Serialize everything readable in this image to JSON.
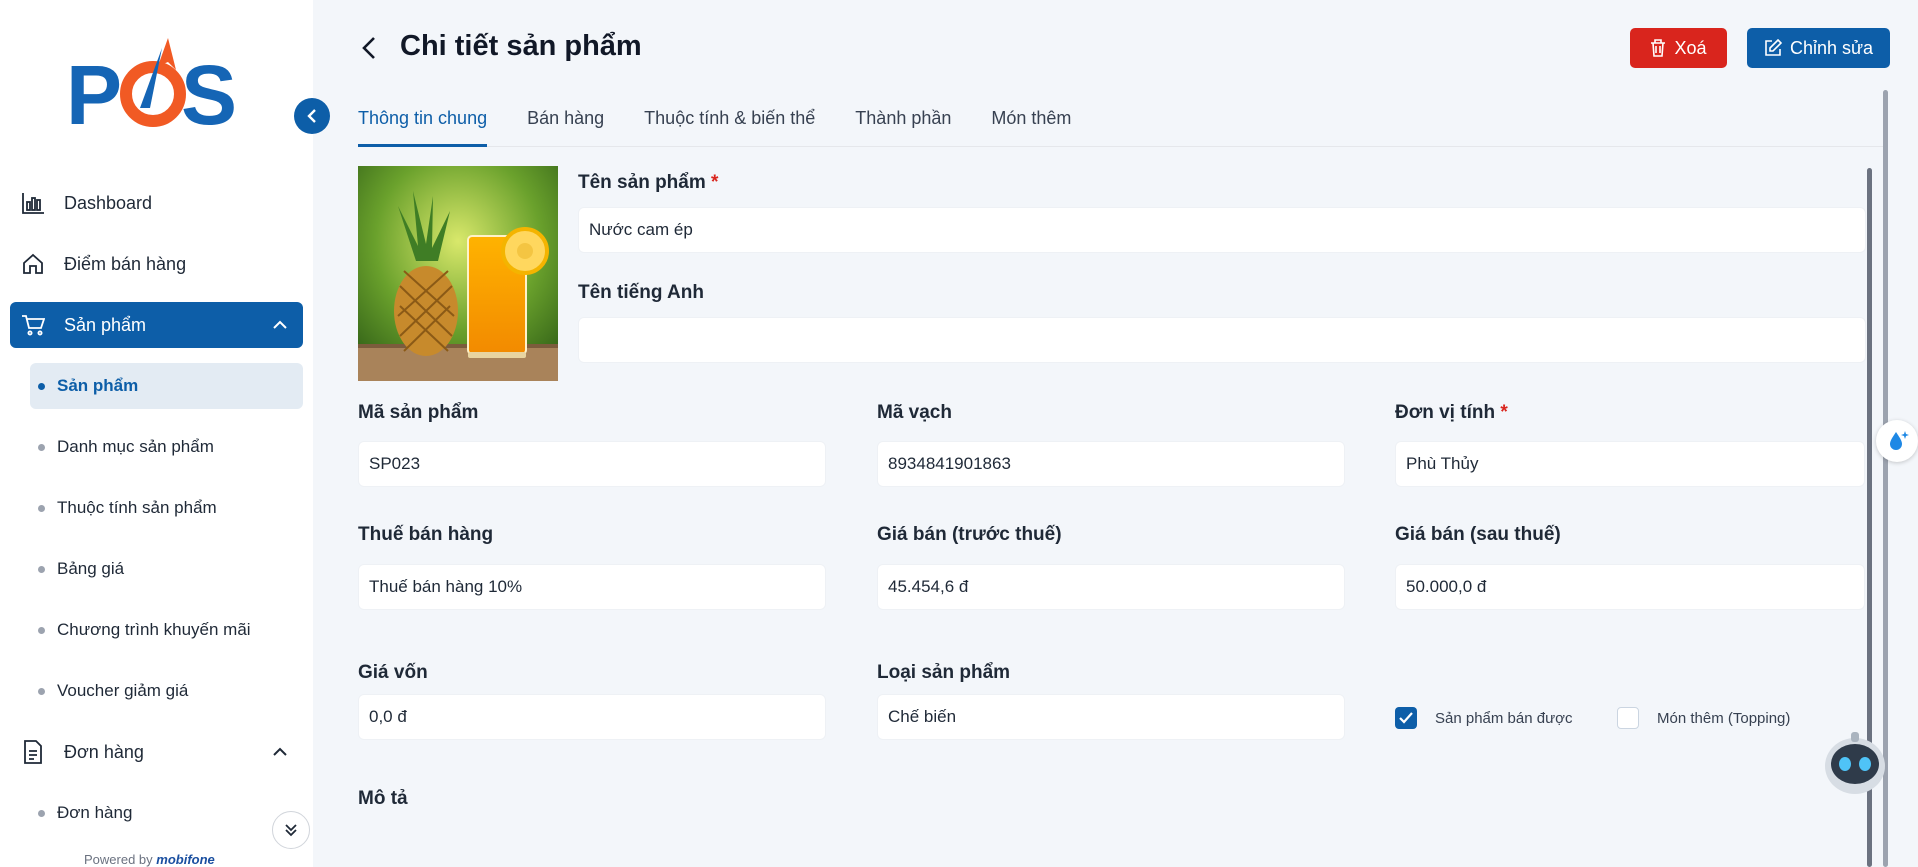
{
  "brand": {
    "logo_text": "POS",
    "powered_by": "Powered by",
    "powered_brand": "mobifone"
  },
  "sidebar": {
    "items": [
      {
        "label": "Dashboard",
        "icon": "chart-bar-icon"
      },
      {
        "label": "Điểm bán hàng",
        "icon": "home-icon"
      },
      {
        "label": "Sản phẩm",
        "icon": "cart-icon",
        "active": true,
        "expanded": true
      }
    ],
    "product_subitems": [
      {
        "label": "Sản phẩm",
        "active": true
      },
      {
        "label": "Danh mục sản phẩm"
      },
      {
        "label": "Thuộc tính sản phẩm"
      },
      {
        "label": "Bảng giá"
      },
      {
        "label": "Chương trình khuyến mãi"
      },
      {
        "label": "Voucher giảm giá"
      }
    ],
    "orders": {
      "label": "Đơn hàng",
      "icon": "document-icon"
    },
    "order_subitems": [
      {
        "label": "Đơn hàng"
      }
    ]
  },
  "header": {
    "title": "Chi tiết sản phẩm",
    "delete_label": "Xoá",
    "edit_label": "Chỉnh sửa"
  },
  "tabs": [
    {
      "label": "Thông tin chung",
      "active": true
    },
    {
      "label": "Bán hàng"
    },
    {
      "label": "Thuộc tính & biến thể"
    },
    {
      "label": "Thành phần"
    },
    {
      "label": "Món thêm"
    }
  ],
  "form": {
    "name_label": "Tên sản phẩm",
    "name_value": "Nước cam ép",
    "english_name_label": "Tên tiếng Anh",
    "english_name_value": "",
    "code_label": "Mã sản phẩm",
    "code_value": "SP023",
    "barcode_label": "Mã vạch",
    "barcode_value": "8934841901863",
    "unit_label": "Đơn vị tính",
    "unit_value": "Phù Thủy",
    "tax_label": "Thuế bán hàng",
    "tax_value": "Thuế bán hàng 10%",
    "price_before_label": "Giá bán (trước thuế)",
    "price_before_value": "45.454,6 đ",
    "price_after_label": "Giá bán (sau thuế)",
    "price_after_value": "50.000,0 đ",
    "cost_label": "Giá vốn",
    "cost_value": "0,0 đ",
    "type_label": "Loại sản phẩm",
    "type_value": "Chế biến",
    "sellable_label": "Sản phẩm bán được",
    "sellable_checked": true,
    "topping_label": "Món thêm (Topping)",
    "topping_checked": false,
    "description_label": "Mô tả",
    "required_mark": "*"
  },
  "colors": {
    "primary": "#0d5ea8",
    "danger": "#d9251d",
    "background": "#f3f6fa"
  }
}
